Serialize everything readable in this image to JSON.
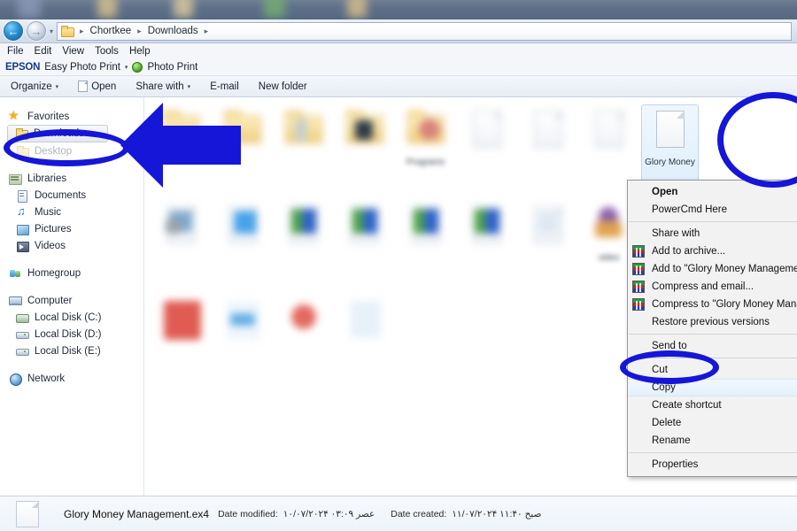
{
  "window": {
    "addressbar": {
      "back_icon": "back-arrow-icon",
      "back_glyph": "←",
      "forward_icon": "forward-arrow-icon",
      "forward_glyph": "→",
      "recent_caret": "▾",
      "folder_icon": "folder-icon",
      "breadcrumbs": [
        "Chortkee",
        "Downloads"
      ],
      "separator": "▸"
    },
    "menubar": [
      "File",
      "Edit",
      "View",
      "Tools",
      "Help"
    ],
    "epsonbar": {
      "logo": "EPSON",
      "label": "Easy Photo Print",
      "caret": "▾",
      "photo_print_icon": "photo-print-icon",
      "photo_print": "Photo Print"
    },
    "commandbar": {
      "organize": "Organize",
      "organize_caret": "▾",
      "open_icon": "file-icon",
      "open": "Open",
      "share_with": "Share with",
      "share_caret": "▾",
      "email": "E-mail",
      "new_folder": "New folder"
    }
  },
  "navpane": {
    "groups": [
      {
        "header": {
          "label": "Favorites",
          "icon": "star-icon"
        },
        "items": [
          {
            "label": "Downloads",
            "icon": "folder-icon",
            "selected": true
          },
          {
            "label": "Desktop",
            "icon": "folder-icon",
            "obscured": true
          }
        ]
      },
      {
        "header": {
          "label": "Libraries",
          "icon": "libraries-icon"
        },
        "items": [
          {
            "label": "Documents",
            "icon": "documents-icon"
          },
          {
            "label": "Music",
            "icon": "music-icon"
          },
          {
            "label": "Pictures",
            "icon": "pictures-icon"
          },
          {
            "label": "Videos",
            "icon": "videos-icon"
          }
        ]
      },
      {
        "header": {
          "label": "Homegroup",
          "icon": "homegroup-icon"
        },
        "items": []
      },
      {
        "header": {
          "label": "Computer",
          "icon": "computer-icon"
        },
        "items": [
          {
            "label": "Local Disk (C:)",
            "icon": "disk-c-icon"
          },
          {
            "label": "Local Disk (D:)",
            "icon": "disk-icon"
          },
          {
            "label": "Local Disk (E:)",
            "icon": "disk-icon"
          }
        ]
      },
      {
        "header": {
          "label": "Network",
          "icon": "network-icon"
        },
        "items": []
      }
    ]
  },
  "files": {
    "row1": [
      {
        "kind": "folder",
        "label": "",
        "blurred": true
      },
      {
        "kind": "folder",
        "label": "",
        "blurred": true
      },
      {
        "kind": "folder",
        "label": "",
        "blurred": true
      },
      {
        "kind": "folder",
        "label": "",
        "blurred": true
      },
      {
        "kind": "folder",
        "label": "Programs",
        "blurred": true,
        "tint": "#d9837a"
      },
      {
        "kind": "doc",
        "label": "",
        "blurred": true
      },
      {
        "kind": "doc",
        "label": "",
        "blurred": true
      },
      {
        "kind": "doc",
        "label": "",
        "blurred": true
      },
      {
        "kind": "doc",
        "label": "Glory Money",
        "selected": true
      }
    ],
    "row2": [
      {
        "kind": "doc",
        "label": "",
        "blurred": true,
        "tint": "#7fa8cf"
      },
      {
        "kind": "doc",
        "label": "",
        "blurred": true,
        "tint": "#4aa3e8"
      },
      {
        "kind": "doc",
        "label": "",
        "blurred": true,
        "tint": "#4fa34a"
      },
      {
        "kind": "doc",
        "label": "",
        "blurred": true,
        "tint": "#4fa34a"
      },
      {
        "kind": "doc",
        "label": "",
        "blurred": true,
        "tint": "#4fa34a"
      },
      {
        "kind": "doc",
        "label": "",
        "blurred": true,
        "tint": "#4fa34a"
      },
      {
        "kind": "doc",
        "label": "",
        "blurred": true,
        "tint": "#dfe9f3"
      },
      {
        "kind": "doc",
        "label": "video",
        "blurred": true,
        "tint": "#8b5fa8"
      }
    ],
    "row3": [
      {
        "kind": "doc",
        "label": "",
        "blurred": true,
        "tint": "#e05b52"
      },
      {
        "kind": "doc",
        "label": "",
        "blurred": true,
        "tint": "#63aee4"
      },
      {
        "kind": "doc",
        "label": "",
        "blurred": true,
        "tint": "#e46a60"
      },
      {
        "kind": "doc",
        "label": "",
        "blurred": true,
        "tint": "#cfe3f4"
      }
    ]
  },
  "context_menu": {
    "items": [
      {
        "label": "Open",
        "bold": true
      },
      {
        "label": "PowerCmd Here"
      },
      {
        "separator": true
      },
      {
        "label": "Share with"
      },
      {
        "label": "Add to archive...",
        "icon": "winrar-icon"
      },
      {
        "label": "Add to \"Glory Money Management.rar\"",
        "icon": "winrar-icon"
      },
      {
        "label": "Compress and email...",
        "icon": "winrar-icon"
      },
      {
        "label": "Compress to \"Glory Money Management.rar\" and email",
        "icon": "winrar-icon"
      },
      {
        "label": "Restore previous versions"
      },
      {
        "separator": true
      },
      {
        "label": "Send to"
      },
      {
        "separator": true
      },
      {
        "label": "Cut"
      },
      {
        "label": "Copy",
        "hover": true
      },
      {
        "label": "Create shortcut"
      },
      {
        "label": "Delete"
      },
      {
        "label": "Rename"
      },
      {
        "separator": true
      },
      {
        "label": "Properties"
      }
    ]
  },
  "details": {
    "icon": "file-icon",
    "filename": "Glory Money Management.ex4",
    "date_modified_label": "Date modified:",
    "date_modified_value": "۱۰/۰۷/۲۰۲۴ عصر ۰۳:۰۹",
    "date_created_label": "Date created:",
    "date_created_value": "۱۱/۰۷/۲۰۲۴ صبح ۱۱:۴۰"
  },
  "annotations": {
    "accent_color": "#1616D8",
    "marks": [
      {
        "name": "downloads-ellipse",
        "shape": "ellipse",
        "target": "Downloads"
      },
      {
        "name": "pointer-arrow",
        "shape": "arrow-left",
        "target": "Downloads"
      },
      {
        "name": "glory-money-ellipse",
        "shape": "ellipse",
        "target": "Glory Money"
      },
      {
        "name": "copy-ellipse",
        "shape": "ellipse",
        "target": "Copy"
      }
    ]
  }
}
